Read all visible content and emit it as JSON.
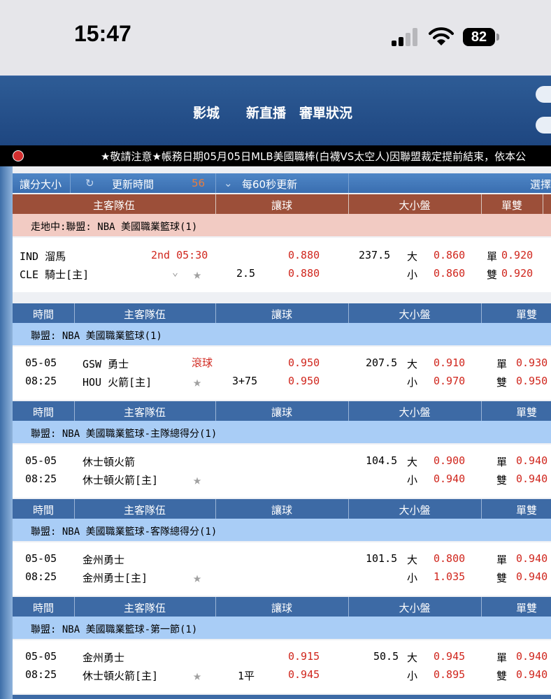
{
  "status_bar": {
    "time": "15:47",
    "battery": "82"
  },
  "header": {
    "nav": [
      "影城",
      "新直播",
      "審單狀況"
    ]
  },
  "marquee": {
    "text": "★敬請注意★帳務日期05月05日MLB美國職棒(白襪VS太空人)因聯盟裁定提前結束，依本公"
  },
  "toolbar": {
    "handicap": "讓分大小",
    "refresh_icon": "↻",
    "update_time": "更新時間",
    "countdown": "56",
    "dropdown_icon": "⌄",
    "interval": "每60秒更新",
    "select": "選擇"
  },
  "live_header": {
    "team": "主客隊伍",
    "spread": "讓球",
    "ou": "大小盤",
    "oe": "單雙"
  },
  "live_league": "走地中:聯盟: NBA 美國職業籃球(1)",
  "live_game": {
    "home_team": "IND 溜馬",
    "away_team": "CLE 騎士[主]",
    "clock": "2nd 05:30",
    "line": "2.5",
    "spread_1": "0.880",
    "spread_2": "0.880",
    "ou_line": "237.5",
    "over": "大",
    "under": "小",
    "over_odds": "0.860",
    "under_odds": "0.860",
    "odd": "單",
    "even": "雙",
    "odd_odds": "0.920",
    "even_odds": "0.920",
    "chevron": "⌄",
    "star": "★"
  },
  "section_header": {
    "time": "時間",
    "team": "主客隊伍",
    "spread": "讓球",
    "ou": "大小盤",
    "oe": "單雙"
  },
  "sections": [
    {
      "league": "聯盟: NBA 美國職業籃球(1)",
      "date": "05-05",
      "time": "08:25",
      "team1": "GSW 勇士",
      "team2": "HOU 火箭[主]",
      "tag": "滾球",
      "line": "3+75",
      "spread_1": "0.950",
      "spread_2": "0.950",
      "ou_line": "207.5",
      "over": "大",
      "under": "小",
      "over_odds": "0.910",
      "under_odds": "0.970",
      "odd": "單",
      "even": "雙",
      "odd_odds": "0.930",
      "even_odds": "0.950",
      "star": "★"
    },
    {
      "league": "聯盟: NBA 美國職業籃球-主隊總得分(1)",
      "date": "05-05",
      "time": "08:25",
      "team1": "休士頓火箭",
      "team2": "休士頓火箭[主]",
      "tag": "",
      "line": "",
      "spread_1": "",
      "spread_2": "",
      "ou_line": "104.5",
      "over": "大",
      "under": "小",
      "over_odds": "0.900",
      "under_odds": "0.940",
      "odd": "單",
      "even": "雙",
      "odd_odds": "0.940",
      "even_odds": "0.940",
      "star": "★"
    },
    {
      "league": "聯盟: NBA 美國職業籃球-客隊總得分(1)",
      "date": "05-05",
      "time": "08:25",
      "team1": "金州勇士",
      "team2": "金州勇士[主]",
      "tag": "",
      "line": "",
      "spread_1": "",
      "spread_2": "",
      "ou_line": "101.5",
      "over": "大",
      "under": "小",
      "over_odds": "0.800",
      "under_odds": "1.035",
      "odd": "單",
      "even": "雙",
      "odd_odds": "0.940",
      "even_odds": "0.940",
      "star": "★"
    },
    {
      "league": "聯盟: NBA 美國職業籃球-第一節(1)",
      "date": "05-05",
      "time": "08:25",
      "team1": "金州勇士",
      "team2": "休士頓火箭[主]",
      "tag": "",
      "line": "1平",
      "spread_1": "0.915",
      "spread_2": "0.945",
      "ou_line": "50.5",
      "over": "大",
      "under": "小",
      "over_odds": "0.945",
      "under_odds": "0.895",
      "odd": "單",
      "even": "雙",
      "odd_odds": "0.940",
      "even_odds": "0.940",
      "star": "★"
    }
  ]
}
